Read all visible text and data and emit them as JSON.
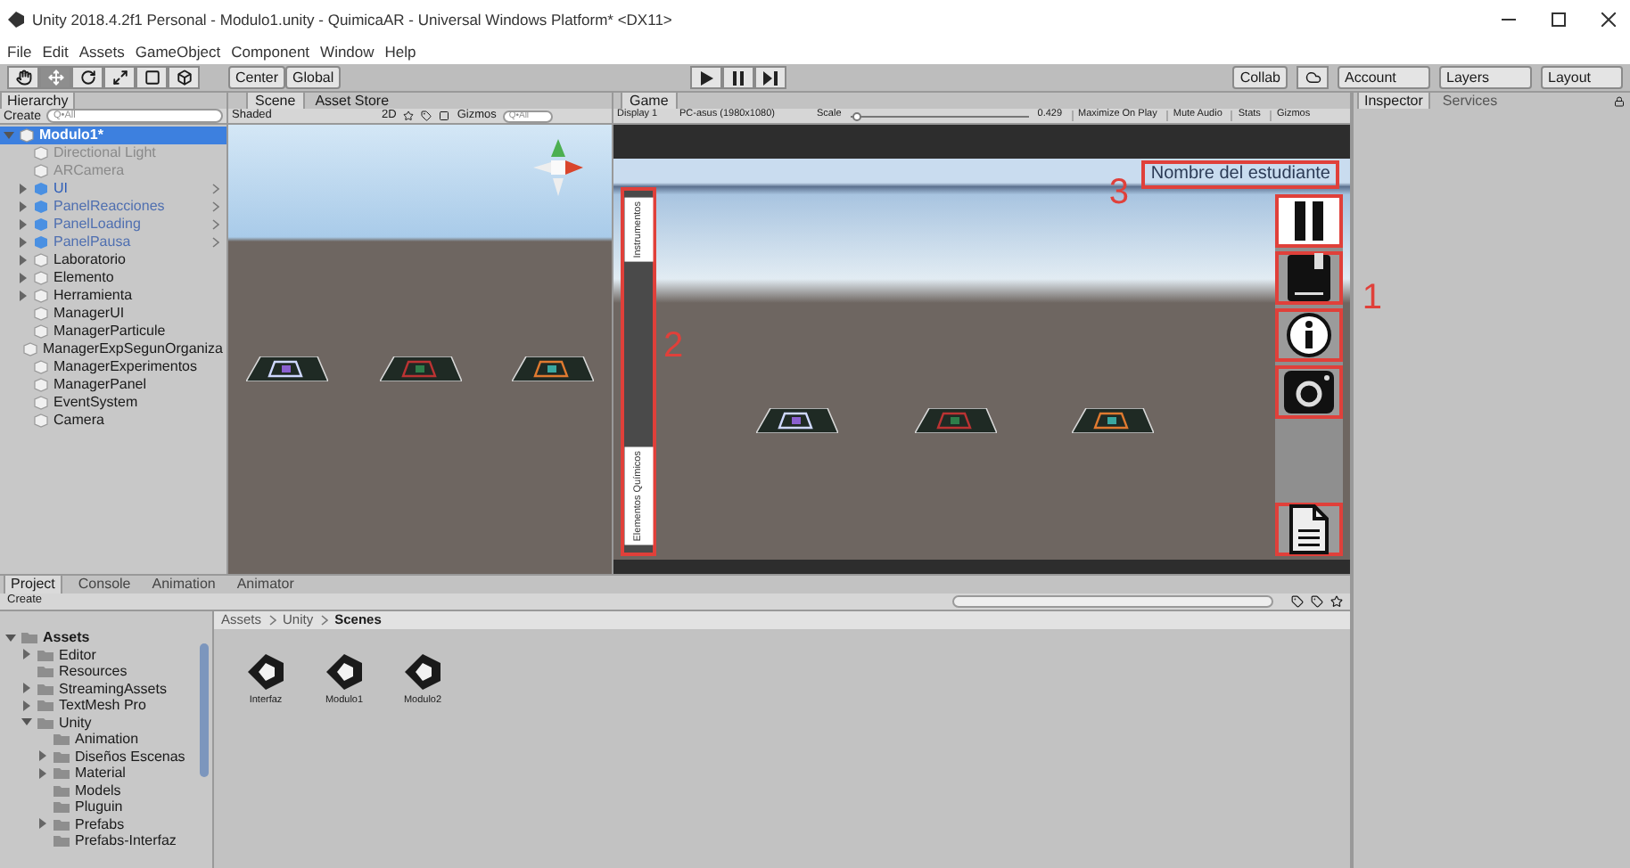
{
  "window": {
    "title": "Unity 2018.4.2f1 Personal - Modulo1.unity - QuimicaAR - Universal Windows Platform* <DX11>"
  },
  "menu": [
    "File",
    "Edit",
    "Assets",
    "GameObject",
    "Component",
    "Window",
    "Help"
  ],
  "toolbar": {
    "pivot": "Center",
    "space": "Global",
    "collab": "Collab",
    "account": "Account",
    "layers": "Layers",
    "layout": "Layout"
  },
  "hierarchy": {
    "title": "Hierarchy",
    "create": "Create",
    "search_placeholder": "Q•All",
    "items": [
      {
        "label": "Modulo1*",
        "selected": true,
        "expanded": true,
        "children": [
          {
            "label": "Directional Light",
            "disabled": true,
            "prefab": false
          },
          {
            "label": "ARCamera",
            "disabled": true,
            "prefab": false
          },
          {
            "label": "UI",
            "expanded": false,
            "prefab": true
          },
          {
            "label": "PanelReacciones",
            "expanded": false,
            "prefab": true,
            "disabled": true
          },
          {
            "label": "PanelLoading",
            "expanded": false,
            "prefab": true,
            "disabled": true
          },
          {
            "label": "PanelPausa",
            "expanded": false,
            "prefab": true,
            "disabled": true
          },
          {
            "label": "Laboratorio",
            "expanded": false,
            "prefab": false
          },
          {
            "label": "Elemento",
            "expanded": false,
            "prefab": false
          },
          {
            "label": "Herramienta",
            "expanded": false,
            "prefab": false
          },
          {
            "label": "ManagerUI",
            "prefab": false
          },
          {
            "label": "ManagerParticule",
            "prefab": false
          },
          {
            "label": "ManagerExpSegunOrganiza",
            "prefab": false
          },
          {
            "label": "ManagerExperimentos",
            "prefab": false
          },
          {
            "label": "ManagerPanel",
            "prefab": false
          },
          {
            "label": "EventSystem",
            "prefab": false
          },
          {
            "label": "Camera",
            "prefab": false
          }
        ]
      }
    ]
  },
  "scene_view": {
    "tabs": [
      {
        "label": "Scene",
        "selected": true
      },
      {
        "label": "Asset Store",
        "selected": false
      }
    ],
    "shading": "Shaded",
    "mode_2d": "2D",
    "gizmos": "Gizmos",
    "search_placeholder": "Q•All"
  },
  "game_view": {
    "tab": "Game",
    "display": "Display 1",
    "resolution": "PC-asus (1980x1080)",
    "scale_label": "Scale",
    "scale": {
      "level": 0.03
    },
    "scale_value": "0.429",
    "toggles": [
      "Maximize On Play",
      "Mute Audio",
      "Stats"
    ],
    "gizmos": "Gizmos",
    "student_name": "Nombre del estudiante",
    "side_tabs": [
      "Instrumentos",
      "Elementos Químicos"
    ],
    "buttons": [
      {
        "kind": "pause"
      },
      {
        "kind": "book"
      },
      {
        "kind": "info"
      },
      {
        "kind": "camera"
      },
      {
        "kind": "document"
      }
    ],
    "annotations": {
      "buttons": "1",
      "side_tabs": "2",
      "student_name": "3"
    }
  },
  "inspector": {
    "tabs": [
      {
        "label": "Inspector",
        "selected": true
      },
      {
        "label": "Services",
        "selected": false
      }
    ]
  },
  "project": {
    "tabs": [
      {
        "label": "Project",
        "selected": true
      },
      {
        "label": "Console",
        "selected": false
      },
      {
        "label": "Animation",
        "selected": false
      },
      {
        "label": "Animator",
        "selected": false
      }
    ],
    "create": "Create",
    "tree": [
      {
        "label": "Assets",
        "expanded": true,
        "children": [
          {
            "label": "Editor",
            "expanded": false
          },
          {
            "label": "Resources"
          },
          {
            "label": "StreamingAssets",
            "expanded": false
          },
          {
            "label": "TextMesh Pro",
            "expanded": false
          },
          {
            "label": "Unity",
            "expanded": true,
            "children": [
              {
                "label": "Animation"
              },
              {
                "label": "Diseños Escenas",
                "expanded": false
              },
              {
                "label": "Material",
                "expanded": false
              },
              {
                "label": "Models"
              },
              {
                "label": "Pluguin"
              },
              {
                "label": "Prefabs",
                "expanded": false
              },
              {
                "label": "Prefabs-Interfaz"
              }
            ]
          }
        ]
      }
    ],
    "breadcrumb": [
      "Assets",
      "Unity",
      "Scenes"
    ],
    "files": [
      "Interfaz",
      "Modulo1",
      "Modulo2"
    ]
  }
}
